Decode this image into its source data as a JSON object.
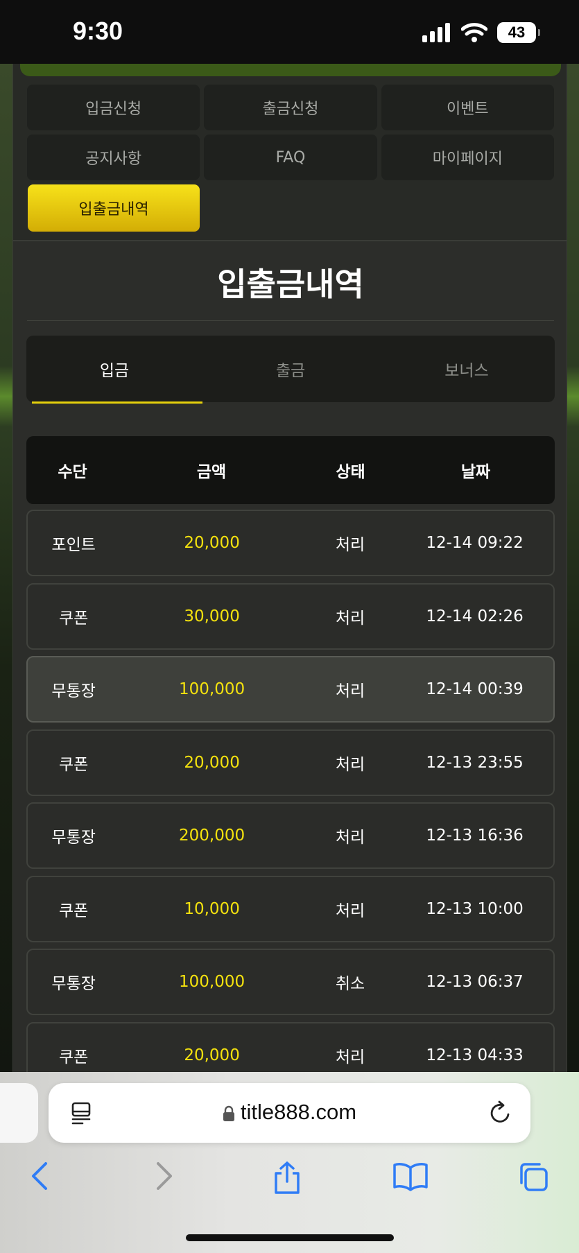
{
  "status_bar": {
    "time": "9:30",
    "battery": "43"
  },
  "menu": {
    "items": [
      "입금신청",
      "출금신청",
      "이벤트",
      "공지사항",
      "FAQ",
      "마이페이지"
    ],
    "active": "입출금내역"
  },
  "page_title": "입출금내역",
  "tabs": [
    {
      "label": "입금",
      "active": true
    },
    {
      "label": "출금",
      "active": false
    },
    {
      "label": "보너스",
      "active": false
    }
  ],
  "table": {
    "headers": [
      "수단",
      "금액",
      "상태",
      "날짜"
    ],
    "rows": [
      {
        "method": "포인트",
        "amount": "20,000",
        "status": "처리",
        "date": "12-14 09:22"
      },
      {
        "method": "쿠폰",
        "amount": "30,000",
        "status": "처리",
        "date": "12-14 02:26"
      },
      {
        "method": "무통장",
        "amount": "100,000",
        "status": "처리",
        "date": "12-14 00:39"
      },
      {
        "method": "쿠폰",
        "amount": "20,000",
        "status": "처리",
        "date": "12-13 23:55"
      },
      {
        "method": "무통장",
        "amount": "200,000",
        "status": "처리",
        "date": "12-13 16:36"
      },
      {
        "method": "쿠폰",
        "amount": "10,000",
        "status": "처리",
        "date": "12-13 10:00"
      },
      {
        "method": "무통장",
        "amount": "100,000",
        "status": "취소",
        "date": "12-13 06:37"
      },
      {
        "method": "쿠폰",
        "amount": "20,000",
        "status": "처리",
        "date": "12-13 04:33"
      }
    ]
  },
  "browser": {
    "url": "title888.com",
    "icons": [
      "reader-icon",
      "lock-icon",
      "reload-icon",
      "back-icon",
      "forward-icon",
      "share-icon",
      "bookmarks-icon",
      "tabs-icon"
    ]
  },
  "colors": {
    "accent_yellow": "#f4e20e",
    "active_button": "#e8c80d",
    "panel": "#282a26"
  }
}
